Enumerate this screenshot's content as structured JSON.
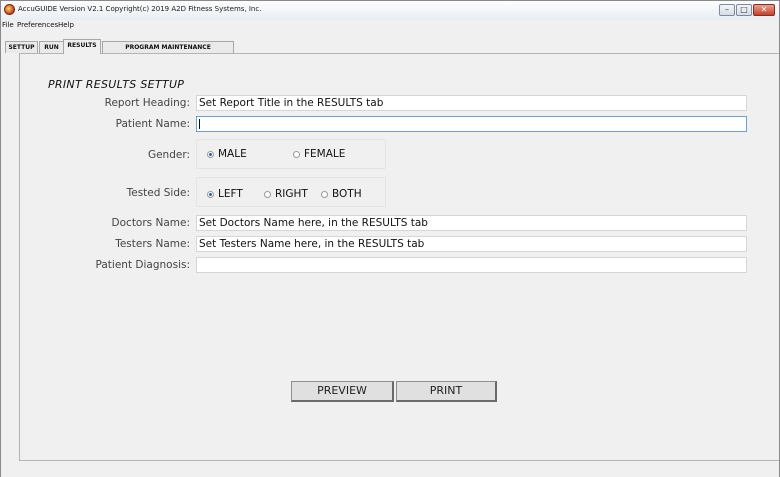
{
  "window": {
    "title": "AccuGUIDE Version V2.1 Copyright(c) 2019 A2D Fitness Systems, Inc.",
    "controls": {
      "minimize": "–",
      "maximize": "□",
      "close": "✕"
    }
  },
  "menu": [
    "File",
    "Preferences",
    "Help"
  ],
  "tabs": [
    {
      "label": "SETTUP",
      "active": false
    },
    {
      "label": "RUN",
      "active": false
    },
    {
      "label": "RESULTS",
      "active": true
    },
    {
      "label": "PROGRAM MAINTENANCE",
      "active": false
    }
  ],
  "form": {
    "section_title": "PRINT RESULTS SETTUP",
    "report_heading": {
      "label": "Report Heading:",
      "value": "Set Report Title in the RESULTS tab"
    },
    "patient_name": {
      "label": "Patient Name:",
      "value": ""
    },
    "gender": {
      "label": "Gender:",
      "options": [
        "MALE",
        "FEMALE"
      ],
      "selected": "MALE"
    },
    "tested_side": {
      "label": "Tested Side:",
      "options": [
        "LEFT",
        "RIGHT",
        "BOTH"
      ],
      "selected": "LEFT"
    },
    "doctors_name": {
      "label": "Doctors Name:",
      "value": "Set Doctors Name here, in the RESULTS tab"
    },
    "testers_name": {
      "label": "Testers Name:",
      "value": "Set Testers Name here, in the RESULTS tab"
    },
    "patient_diagnosis": {
      "label": "Patient Diagnosis:",
      "value": ""
    }
  },
  "buttons": {
    "preview": "PREVIEW",
    "print": "PRINT"
  },
  "icons": {
    "app": "app-logo-icon"
  },
  "colors": {
    "radio_selected": "#2a5db0",
    "focus_border": "#6aa0d8",
    "close_button": "#c6402c"
  }
}
